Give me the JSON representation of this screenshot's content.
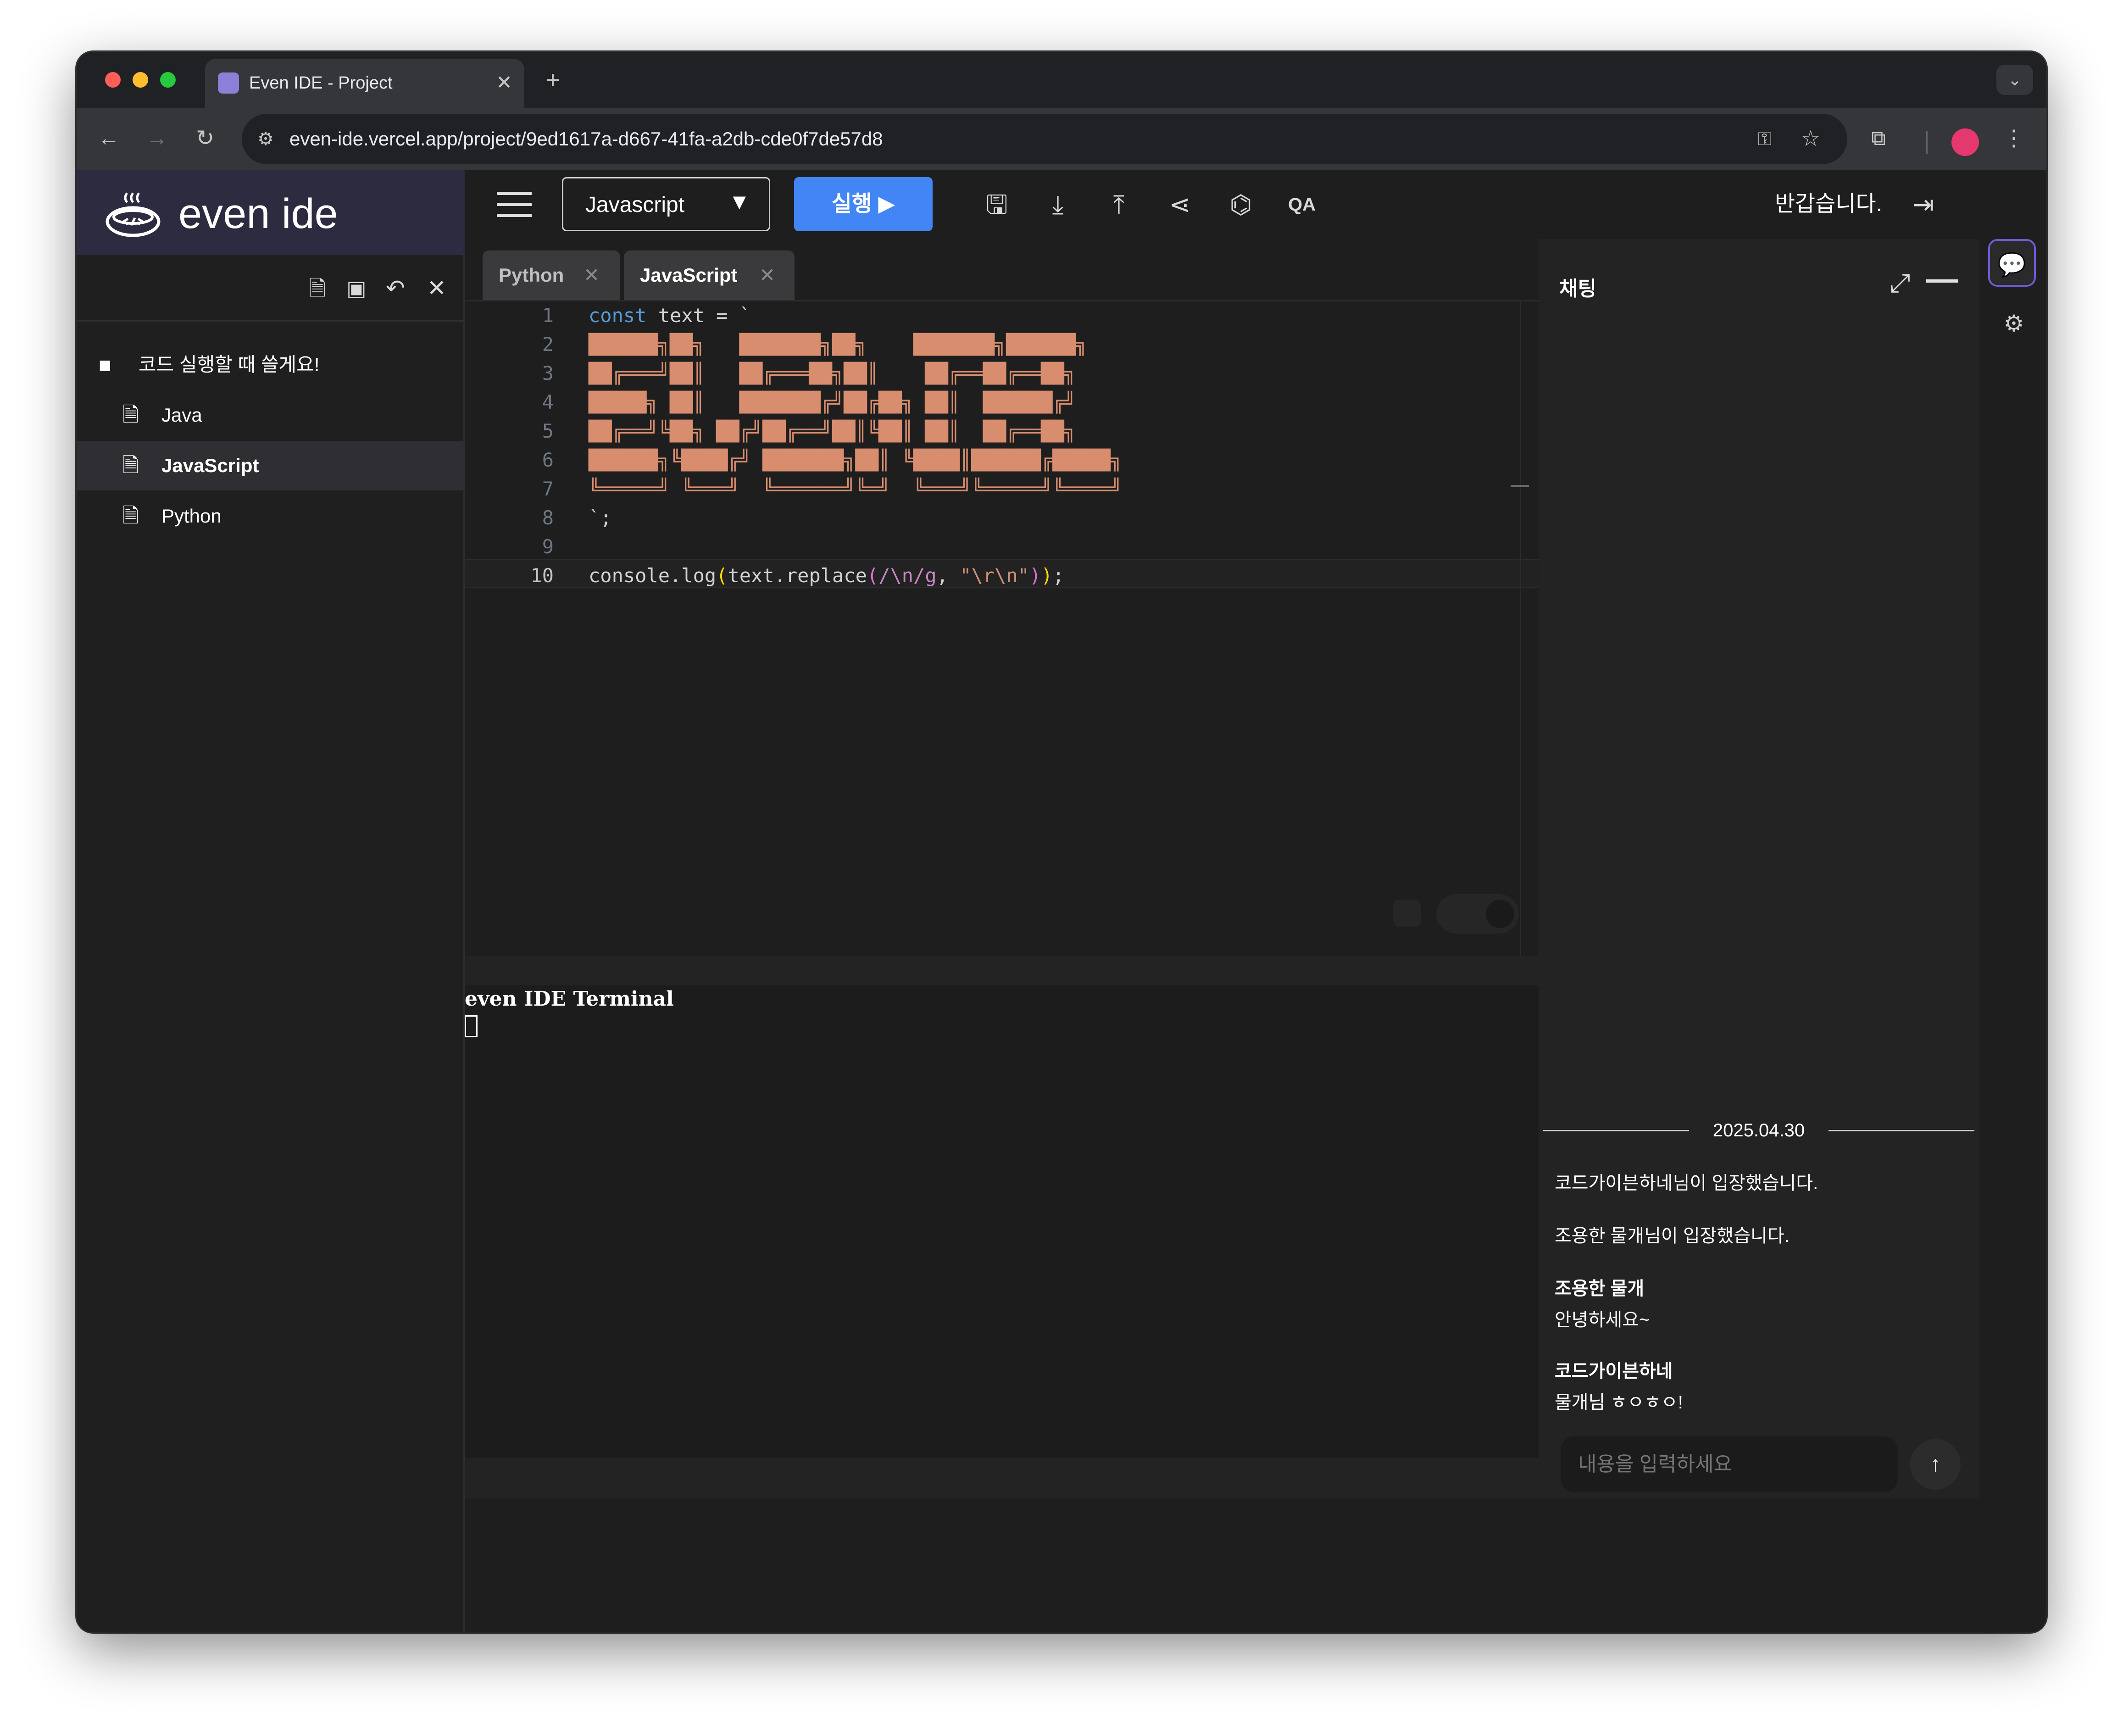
{
  "browser": {
    "tab_title": "Even IDE - Project",
    "url": "even-ide.vercel.app/project/9ed1617a-d667-41fa-a2db-cde0f7de57d8",
    "icons": [
      "back-icon",
      "forward-icon",
      "reload-icon",
      "site-settings-icon",
      "key-icon",
      "star-icon",
      "extensions-icon",
      "profile-avatar",
      "menu-icon"
    ]
  },
  "sidebar": {
    "brand": "even ide",
    "folder_name": "코드 실행할 때 쓸게요!",
    "files": [
      {
        "label": "Java",
        "active": false
      },
      {
        "label": "JavaScript",
        "active": true
      },
      {
        "label": "Python",
        "active": false
      }
    ]
  },
  "topbar": {
    "language": "Javascript",
    "run_label": "실행 ▶",
    "greeting": "반갑습니다."
  },
  "editor": {
    "tabs": [
      {
        "label": "Python",
        "active": false
      },
      {
        "label": "JavaScript",
        "active": true
      }
    ],
    "line_numbers": [
      "1",
      "2",
      "3",
      "4",
      "5",
      "6",
      "7",
      "8",
      "9",
      "10"
    ],
    "line1_keyword": "const",
    "line1_rest": " text = `",
    "ascii_art": [
      "██████╗██╗   ███████╗██╗    ███████╗██████╗",
      "██╔═══╝██║   ██╔═══██╗██║    ██╔══██╔══██╗",
      "█████╗ ██║   ███████╔╝██╔██╗ ██║  ██████╔╝",
      "██╔══╝╚██╗ ██╔╝██╔══╝██║╚██║ ██║  ██╔══██╗",
      "██████╗╚████╔╝ ███████╗██║ ╚████║██████╔█████╗",
      "╚═════╝ ╚═══╝  ╚══════╝╚═╝  ╚═══╝╚═════╝╚════╝"
    ],
    "line8": "`;",
    "line10": {
      "a": "console.log",
      "b": "(",
      "c": "text.replace",
      "d": "(",
      "e": "/\\n/g",
      "f": ", ",
      "g": "\"\\r\\n\"",
      "h": ")",
      "i": ")",
      "j": ";"
    },
    "accent_colors": {
      "keyword": "#569cd6",
      "string": "#ce9178",
      "regex": "#c586c0",
      "paren": "#ffd700",
      "art": "#d88e6e"
    }
  },
  "terminal": {
    "title": "even IDE Terminal"
  },
  "chat": {
    "title": "채팅",
    "date": "2025.04.30",
    "system_messages": [
      "코드가이븐하네님이 입장했습니다.",
      "조용한 물개님이 입장했습니다."
    ],
    "messages": [
      {
        "author": "조용한 물개",
        "text": "안녕하세요~"
      },
      {
        "author": "코드가이븐하네",
        "text": "물개님 ㅎㅇㅎㅇ!"
      }
    ],
    "input_placeholder": "내용을 입력하세요"
  }
}
